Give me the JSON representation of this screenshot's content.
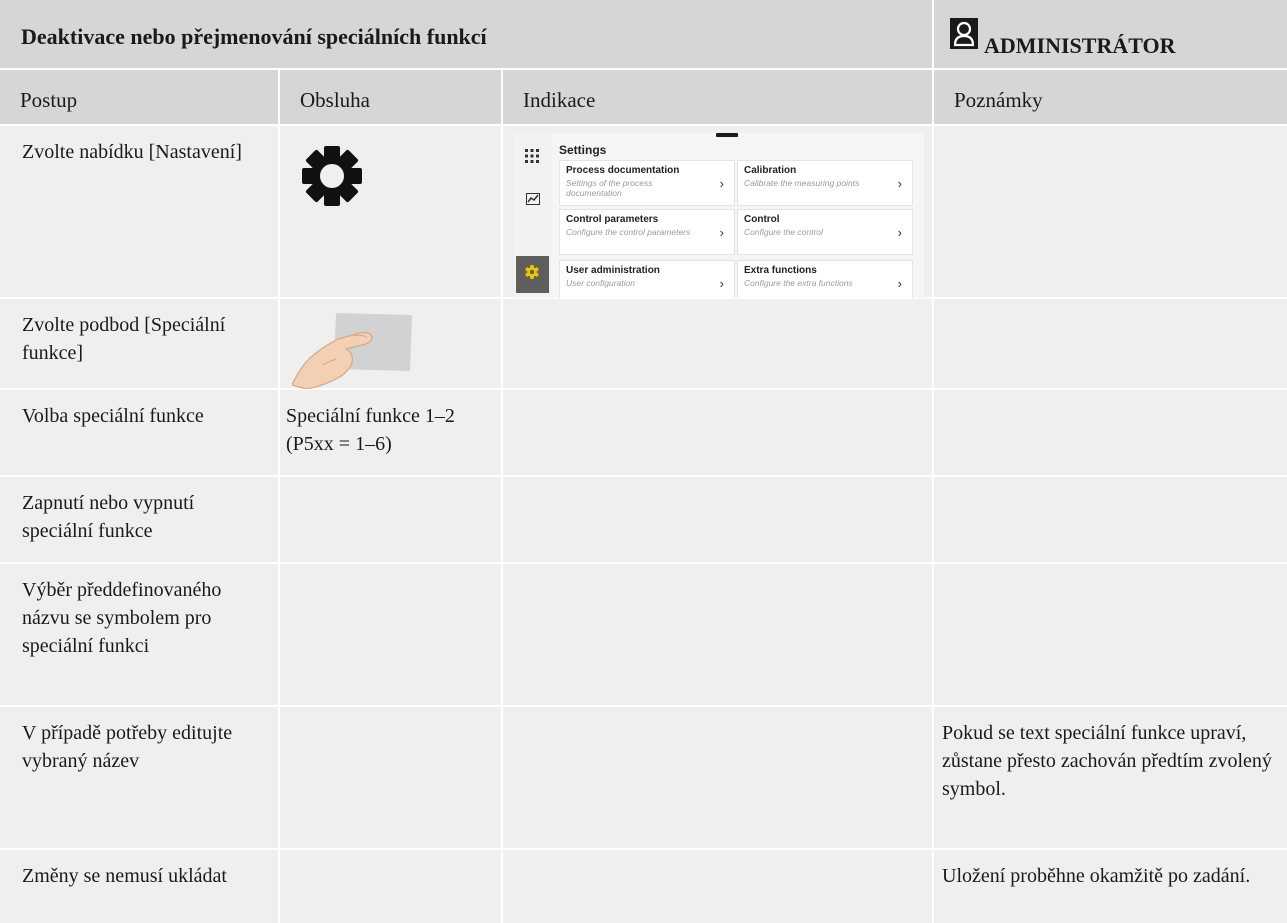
{
  "title": "Deaktivace nebo přejmenování speciálních funkcí",
  "role": {
    "label": "ADMINISTRÁTOR",
    "icon": "user-icon"
  },
  "columns": [
    "Postup",
    "Obsluha",
    "Indikace",
    "Poznámky"
  ],
  "rows": [
    {
      "postup": "Zvolte nabídku [Nastavení]",
      "obsluha_icon": "gear-icon",
      "obsluha": "",
      "indikace": "settings-screenshot",
      "poznamky": ""
    },
    {
      "postup": "Zvolte podbod [Speciální funkce]",
      "obsluha_icon": "hand-tap-icon",
      "obsluha": "",
      "indikace": "",
      "poznamky": ""
    },
    {
      "postup": "Volba speciální funkce",
      "obsluha": "Speciální funkce 1–2 (P5xx = 1–6)",
      "indikace": "",
      "poznamky": ""
    },
    {
      "postup": "Zapnutí nebo vypnutí speciální funkce",
      "obsluha": "",
      "indikace": "",
      "poznamky": ""
    },
    {
      "postup": "Výběr předdefinovaného názvu se symbolem pro speciální funkci",
      "obsluha": "",
      "indikace": "",
      "poznamky": ""
    },
    {
      "postup": "V případě potřeby editujte vybraný název",
      "obsluha": "",
      "indikace": "",
      "poznamky": "Pokud se text speciální funkce upraví, zůstane přesto zachován předtím zvolený symbol."
    },
    {
      "postup": "Změny se nemusí ukládat",
      "obsluha": "",
      "indikace": "",
      "poznamky": "Uložení proběhne okamžitě po zadání."
    }
  ],
  "settings_screen": {
    "title": "Settings",
    "sidebar_icons": [
      "apps-grid-icon",
      "chart-icon",
      "gear-icon"
    ],
    "tiles": [
      {
        "title": "Process documentation",
        "subtitle": "Settings of the process documentation"
      },
      {
        "title": "Calibration",
        "subtitle": "Calibrate the measuring points"
      },
      {
        "title": "Control parameters",
        "subtitle": "Configure the control parameters"
      },
      {
        "title": "Control",
        "subtitle": "Configure the control"
      },
      {
        "title": "User administration",
        "subtitle": "User configuration"
      },
      {
        "title": "Extra functions",
        "subtitle": "Configure the extra functions"
      }
    ]
  },
  "colors": {
    "header_bg": "#d6d6d6",
    "cell_bg": "#efefef",
    "accent_yellow": "#e8c800"
  }
}
